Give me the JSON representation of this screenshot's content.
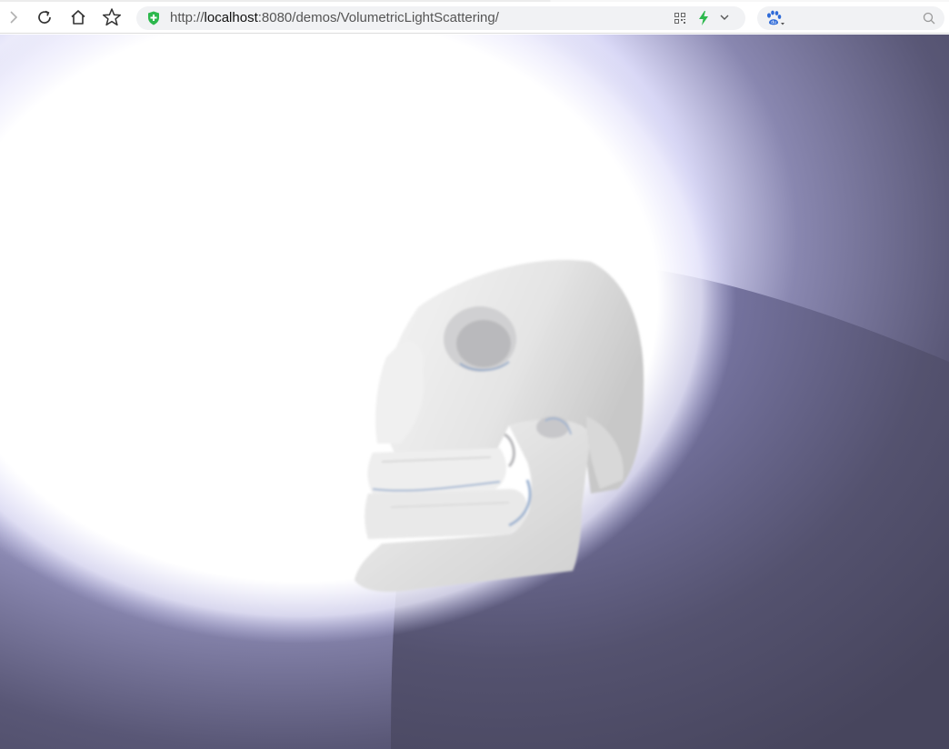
{
  "browser": {
    "url_scheme": "http://",
    "url_host": "localhost",
    "url_rest": ":8080/demos/VolumetricLightScattering/",
    "search_placeholder": "",
    "icons": {
      "back": "chevron-right-icon",
      "reload": "reload-icon",
      "home": "home-icon",
      "bookmark": "star-icon",
      "security": "shield-icon",
      "qr": "qr-code-icon",
      "speed": "lightning-icon",
      "dropdown": "chevron-down-icon",
      "search_engine": "baidu-paw-icon",
      "search": "search-icon"
    },
    "colors": {
      "shield": "#2db84d",
      "bolt": "#2db84d",
      "paw": "#2f6bd8"
    }
  },
  "scene": {
    "description_colors": {
      "light": "#ffffff",
      "halo": "#c9c8f2",
      "background": "#4a4866",
      "sphere_light": "#9896c4",
      "skull": "#e9e9e9"
    }
  }
}
